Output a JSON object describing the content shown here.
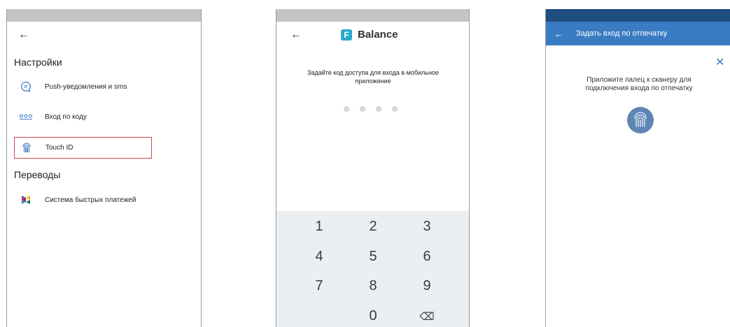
{
  "screen1": {
    "back": "←",
    "settings_header": "Настройки",
    "items": [
      {
        "label": "Push-уведомления и sms",
        "icon": "chat-bubble-icon"
      },
      {
        "label": "Вход по коду",
        "icon": "pin-code-icon"
      },
      {
        "label": "Touch ID",
        "icon": "fingerprint-icon",
        "highlighted": true
      }
    ],
    "transfers_header": "Переводы",
    "transfer_items": [
      {
        "label": "Система быстрых платежей",
        "icon": "sbp-logo-icon"
      }
    ]
  },
  "screen2": {
    "back": "←",
    "logo_mark": "F",
    "logo_text": "Balance",
    "prompt": "Задайте код доступа для входа в мобильное приложение",
    "pin_length": 4,
    "pin_filled": 0,
    "keys": [
      "1",
      "2",
      "3",
      "4",
      "5",
      "6",
      "7",
      "8",
      "9",
      "0",
      "⌫"
    ]
  },
  "screen3": {
    "back": "←",
    "title": "Задать вход по отпечатку",
    "close": "✕",
    "prompt": "Приложите палец к сканеру для подключения входа по отпечатку",
    "accent": "#3a7cc4"
  }
}
